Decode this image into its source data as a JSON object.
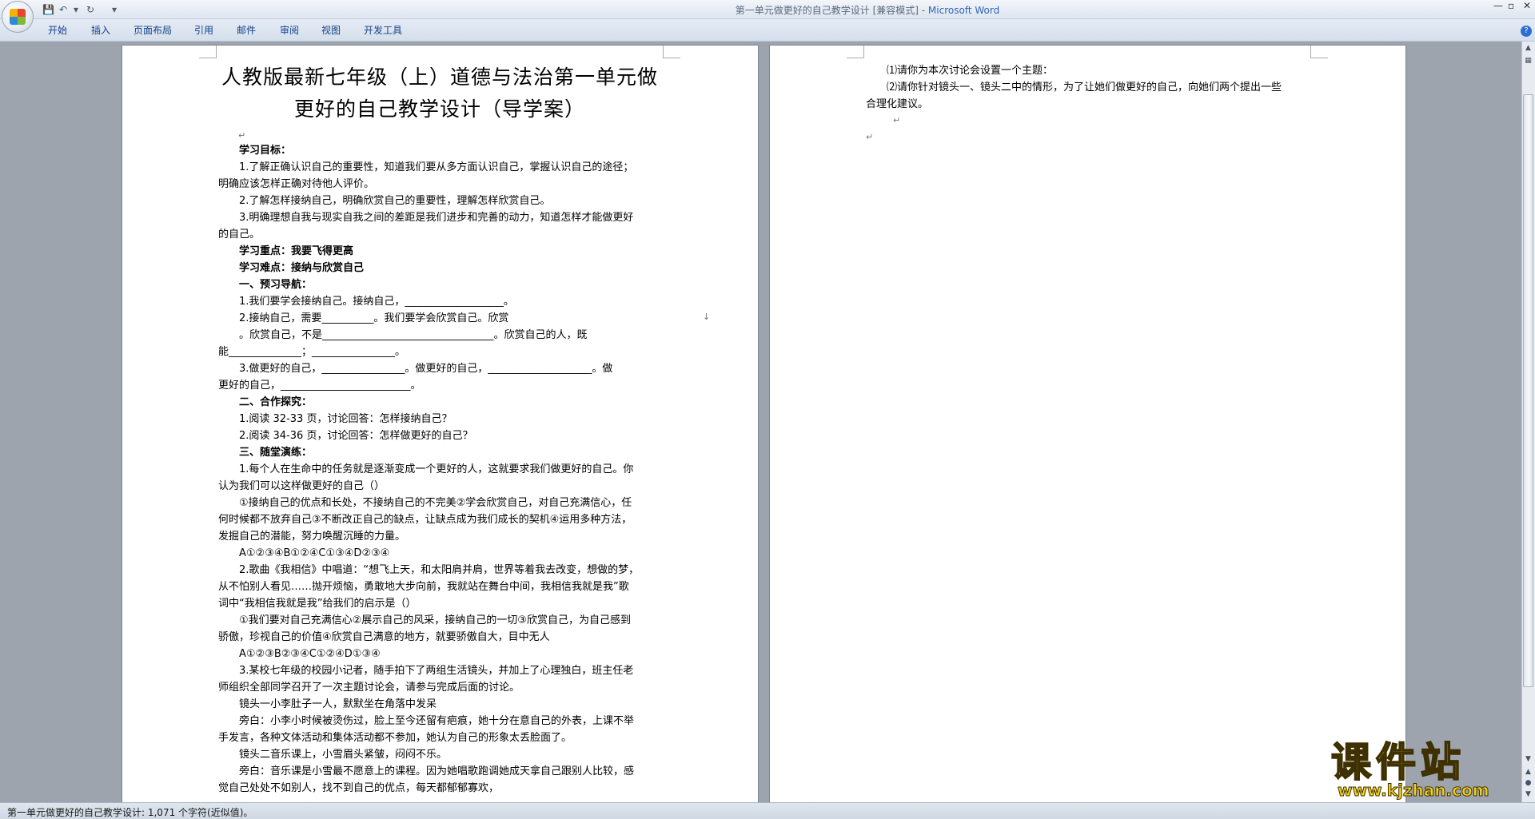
{
  "window": {
    "title": "第一单元做更好的自己教学设计 [兼容模式] - ",
    "app_name": "Microsoft Word",
    "minimize": "—",
    "maximize": "▫",
    "close": "✕"
  },
  "quick_access": {
    "save_icon": "floppy-disk-icon",
    "undo_icon": "undo-arrow-icon",
    "redo_icon": "redo-arrow-icon",
    "customize_icon": "dropdown-arrow-icon"
  },
  "ribbon": {
    "tabs": [
      "开始",
      "插入",
      "页面布局",
      "引用",
      "邮件",
      "审阅",
      "视图",
      "开发工具"
    ],
    "help_icon": "question-mark-icon",
    "help": "?"
  },
  "page1": {
    "title_line1": "人教版最新七年级（上）道德与法治第一单元做",
    "title_line2": "更好的自己教学设计（导学案）",
    "lines": [
      "学习目标：",
      "1.了解正确认识自己的重要性，知道我们要从多方面认识自己，掌握认识自己的途径；",
      "明确应该怎样正确对待他人评价。",
      "2.了解怎样接纳自己，明确欣赏自己的重要性，理解怎样欣赏自己。",
      "3.明确理想自我与现实自我之间的差距是我们进步和完善的动力，知道怎样才能做更好",
      "的自己。",
      "学习重点：我要飞得更高",
      "学习难点：接纳与欣赏自己",
      "一、预习导航：",
      "1.我们要学会接纳自己。接纳自己，___________________。",
      "2.接纳自己，需要__________。我们要学会欣赏自己。欣赏",
      "。欣赏自己，不是_________________________________。欣赏自己的人，既",
      "能______________；________________。",
      "3.做更好的自己，________________。做更好的自己，____________________。做",
      "更好的自己，_________________________。",
      "二、合作探究：",
      "1.阅读 32-33 页，讨论回答：怎样接纳自己？",
      "2.阅读 34-36 页，讨论回答：怎样做更好的自己？",
      "三、随堂演练：",
      "1.每个人在生命中的任务就是逐渐变成一个更好的人，这就要求我们做更好的自己。你",
      "认为我们可以这样做更好的自己（）",
      "①接纳自己的优点和长处，不接纳自己的不完美②学会欣赏自己，对自己充满信心，任",
      "何时候都不放弃自己③不断改正自己的缺点，让缺点成为我们成长的契机④运用多种方法，",
      "发掘自己的潜能，努力唤醒沉睡的力量。",
      "A①②③④B①②④C①③④D②③④",
      "2.歌曲《我相信》中唱道：“想飞上天，和太阳肩并肩，世界等着我去改变，想做的梦，",
      "从不怕别人看见……抛开烦恼，勇敢地大步向前，我就站在舞台中间，我相信我就是我”歌",
      "词中“我相信我就是我”给我们的启示是（）",
      "①我们要对自己充满信心②展示自己的风采，接纳自己的一切③欣赏自己，为自己感到",
      "骄傲，珍视自己的价值④欣赏自己满意的地方，就要骄傲自大，目中无人",
      "A①②③B②③④C①②④D①③④",
      "3.某校七年级的校园小记者，随手拍下了两组生活镜头，并加上了心理独白，班主任老",
      "师组织全部同学召开了一次主题讨论会，请参与完成后面的讨论。",
      "镜头一小李肚子一人，默默坐在角落中发呆",
      "旁白：小李小时候被烫伤过，脸上至今还留有疤痕，她十分在意自己的外表，上课不举",
      "手发言，各种文体活动和集体活动都不参加，她认为自己的形象太丢脸面了。",
      "镜头二音乐课上，小雪眉头紧皱，闷闷不乐。",
      "旁白：音乐课是小雪最不愿意上的课程。因为她唱歌跑调她成天拿自己跟别人比较，感",
      "觉自己处处不如别人，找不到自己的优点，每天都郁郁寡欢，"
    ]
  },
  "page2": {
    "lines": [
      "⑴请你为本次讨论会设置一个主题：",
      "⑵请你针对镜头一、镜头二中的情形，为了让她们做更好的自己，向她们两个提出一些",
      "合理化建议。"
    ]
  },
  "status": {
    "text": "第一单元做更好的自己教学设计: 1,071 个字符(近似值)。"
  },
  "watermark": {
    "title": "课件站",
    "url": "www.kjzhan.com"
  }
}
